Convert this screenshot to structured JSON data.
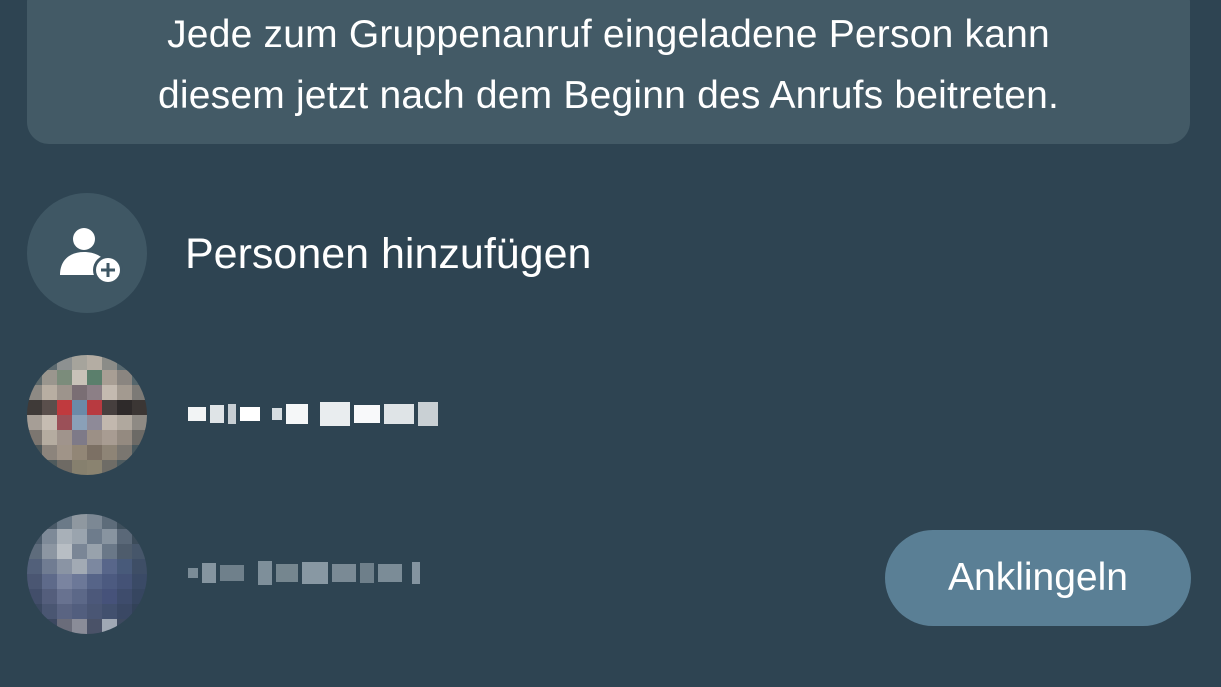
{
  "banner": {
    "line1": "Jede zum Gruppenanruf eingeladene Person kann",
    "line2": "diesem jetzt nach dem Beginn des Anrufs beitreten."
  },
  "add_people": {
    "label": "Personen hinzufügen",
    "icon": "add-person-icon"
  },
  "contacts": [
    {
      "name_pixelated": true,
      "action_label": ""
    },
    {
      "name_pixelated": true,
      "action_label": "Anklingeln"
    }
  ],
  "colors": {
    "background": "#2e4452",
    "banner": "#435a66",
    "icon_circle": "#3f5764",
    "ring_button": "#5a7f95",
    "text": "#ffffff"
  }
}
